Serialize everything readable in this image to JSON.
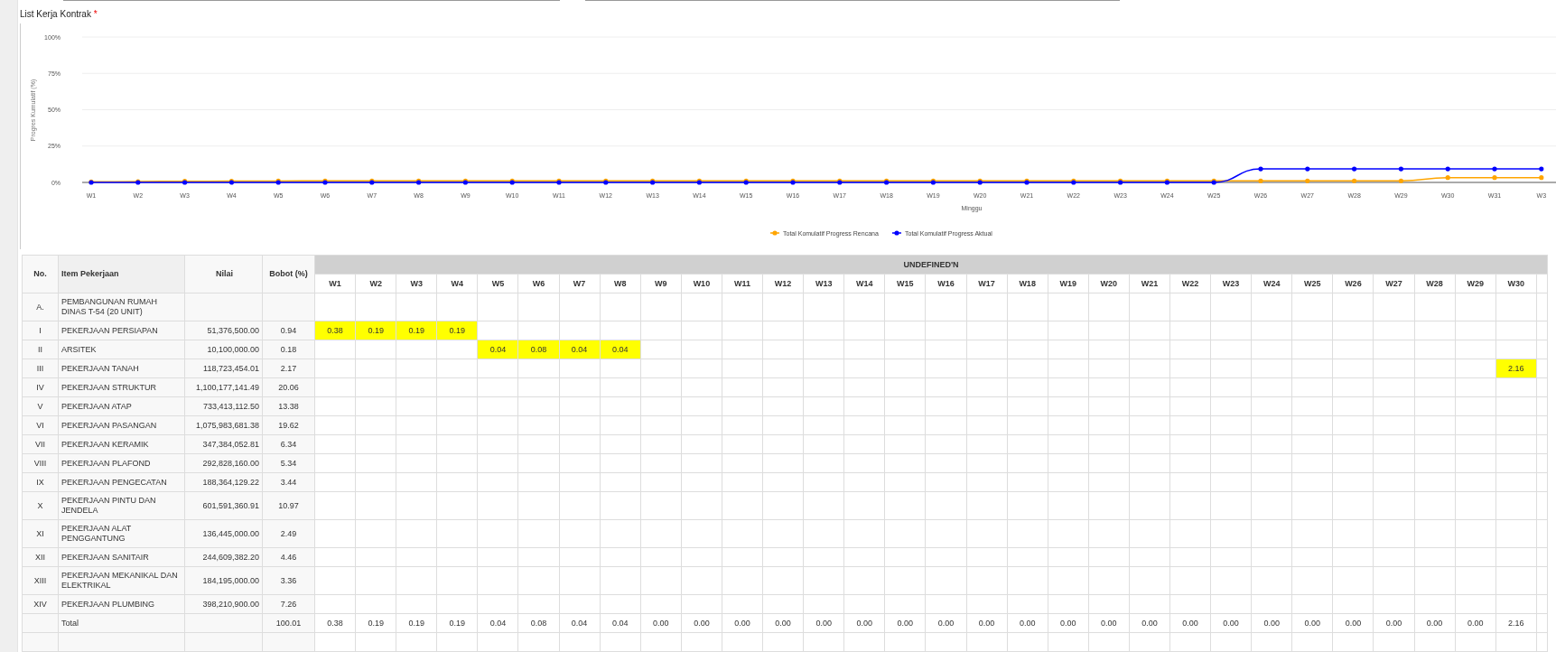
{
  "section": {
    "title": "List Kerja Kontrak",
    "required_mark": "*"
  },
  "chart": {
    "chart_data": {
      "type": "line",
      "grid": true,
      "legend": true,
      "xlabel": "Minggu",
      "ylabel": "Progres Kumulatif (%)",
      "categories": [
        "W1",
        "W2",
        "W3",
        "W4",
        "W5",
        "W6",
        "W7",
        "W8",
        "W9",
        "W10",
        "W11",
        "W12",
        "W13",
        "W14",
        "W15",
        "W16",
        "W17",
        "W18",
        "W19",
        "W20",
        "W21",
        "W22",
        "W23",
        "W24",
        "W25",
        "W26",
        "W27",
        "W28",
        "W29",
        "W30",
        "W31",
        "W3"
      ],
      "ylim": [
        0,
        100
      ],
      "yticks": [
        {
          "value": 0,
          "label": "0%"
        },
        {
          "value": 25,
          "label": "25%"
        },
        {
          "value": 50,
          "label": "50%"
        },
        {
          "value": 75,
          "label": "75%"
        },
        {
          "value": 100,
          "label": "100%"
        }
      ],
      "series": [
        {
          "name": "Total Komulatif Progress Rencana",
          "color": "#ffa500",
          "values": [
            0.4,
            0.6,
            0.8,
            0.9,
            1,
            1.1,
            1.1,
            1.1,
            1.1,
            1.1,
            1.1,
            1.1,
            1.1,
            1.1,
            1.1,
            1.1,
            1.1,
            1.1,
            1.1,
            1.1,
            1.1,
            1.1,
            1.1,
            1.1,
            1.1,
            1.1,
            1.1,
            1.1,
            1.1,
            3.3,
            3.3,
            3.3
          ]
        },
        {
          "name": "Total Komulatif Progress Aktual",
          "color": "#0000ff",
          "values": [
            0,
            0,
            0,
            0,
            0,
            0,
            0,
            0,
            0,
            0,
            0,
            0,
            0,
            0,
            0,
            0,
            0,
            0,
            0,
            0,
            0,
            0,
            0,
            0,
            0,
            9.3,
            9.3,
            9.3,
            9.3,
            9.3,
            9.3,
            9.3
          ]
        }
      ]
    }
  },
  "table": {
    "columns": {
      "no": "No.",
      "item": "Item Pekerjaan",
      "nilai": "Nilai",
      "bobot": "Bobot (%)",
      "group": "UNDEFINED'N",
      "weeks": [
        "W1",
        "W2",
        "W3",
        "W4",
        "W5",
        "W6",
        "W7",
        "W8",
        "W9",
        "W10",
        "W11",
        "W12",
        "W13",
        "W14",
        "W15",
        "W16",
        "W17",
        "W18",
        "W19",
        "W20",
        "W21",
        "W22",
        "W23",
        "W24",
        "W25",
        "W26",
        "W27",
        "W28",
        "W29",
        "W30"
      ]
    },
    "rows": [
      {
        "no": "A.",
        "item": "PEMBANGUNAN RUMAH DINAS T-54 (20 UNIT)",
        "cells": []
      },
      {
        "no": "I",
        "item": "PEKERJAAN PERSIAPAN",
        "nilai": "51,376,500.00",
        "bobot": "0.94",
        "cells": [
          {
            "value": "0.38",
            "highlighted": true
          },
          {
            "value": "0.19",
            "highlighted": true
          },
          {
            "value": "0.19",
            "highlighted": true
          },
          {
            "value": "0.19",
            "highlighted": true
          }
        ]
      },
      {
        "no": "II",
        "item": "ARSITEK",
        "nilai": "10,100,000.00",
        "bobot": "0.18",
        "cells": [
          null,
          null,
          null,
          null,
          {
            "value": "0.04",
            "highlighted": true
          },
          {
            "value": "0.08",
            "highlighted": true
          },
          {
            "value": "0.04",
            "highlighted": true
          },
          {
            "value": "0.04",
            "highlighted": true
          }
        ]
      },
      {
        "no": "III",
        "item": "PEKERJAAN TANAH",
        "nilai": "118,723,454.01",
        "bobot": "2.17",
        "cells": [
          null,
          null,
          null,
          null,
          null,
          null,
          null,
          null,
          null,
          null,
          null,
          null,
          null,
          null,
          null,
          null,
          null,
          null,
          null,
          null,
          null,
          null,
          null,
          null,
          null,
          null,
          null,
          null,
          null,
          {
            "value": "2.16",
            "highlighted": true
          }
        ]
      },
      {
        "no": "IV",
        "item": "PEKERJAAN STRUKTUR",
        "nilai": "1,100,177,141.49",
        "bobot": "20.06",
        "cells": []
      },
      {
        "no": "V",
        "item": "PEKERJAAN ATAP",
        "nilai": "733,413,112.50",
        "bobot": "13.38",
        "cells": []
      },
      {
        "no": "VI",
        "item": "PEKERJAAN PASANGAN",
        "nilai": "1,075,983,681.38",
        "bobot": "19.62",
        "cells": []
      },
      {
        "no": "VII",
        "item": "PEKERJAAN KERAMIK",
        "nilai": "347,384,052.81",
        "bobot": "6.34",
        "cells": []
      },
      {
        "no": "VIII",
        "item": "PEKERJAAN PLAFOND",
        "nilai": "292,828,160.00",
        "bobot": "5.34",
        "cells": []
      },
      {
        "no": "IX",
        "item": "PEKERJAAN PENGECATAN",
        "nilai": "188,364,129.22",
        "bobot": "3.44",
        "cells": []
      },
      {
        "no": "X",
        "item": "PEKERJAAN PINTU DAN JENDELA",
        "nilai": "601,591,360.91",
        "bobot": "10.97",
        "cells": []
      },
      {
        "no": "XI",
        "item": "PEKERJAAN ALAT PENGGANTUNG",
        "nilai": "136,445,000.00",
        "bobot": "2.49",
        "cells": []
      },
      {
        "no": "XII",
        "item": "PEKERJAAN SANITAIR",
        "nilai": "244,609,382.20",
        "bobot": "4.46",
        "cells": []
      },
      {
        "no": "XIII",
        "item": "PEKERJAAN MEKANIKAL DAN ELEKTRIKAL",
        "nilai": "184,195,000.00",
        "bobot": "3.36",
        "cells": []
      },
      {
        "no": "XIV",
        "item": "PEKERJAAN PLUMBING",
        "nilai": "398,210,900.00",
        "bobot": "7.26",
        "cells": []
      },
      {
        "item": "Total",
        "bobot": "100.01",
        "cells": [
          {
            "value": "0.38",
            "highlighted": false
          },
          {
            "value": "0.19",
            "highlighted": false
          },
          {
            "value": "0.19",
            "highlighted": false
          },
          {
            "value": "0.19",
            "highlighted": false
          },
          {
            "value": "0.04",
            "highlighted": false
          },
          {
            "value": "0.08",
            "highlighted": false
          },
          {
            "value": "0.04",
            "highlighted": false
          },
          {
            "value": "0.04",
            "highlighted": false
          },
          {
            "value": "0.00",
            "highlighted": false
          },
          {
            "value": "0.00",
            "highlighted": false
          },
          {
            "value": "0.00",
            "highlighted": false
          },
          {
            "value": "0.00",
            "highlighted": false
          },
          {
            "value": "0.00",
            "highlighted": false
          },
          {
            "value": "0.00",
            "highlighted": false
          },
          {
            "value": "0.00",
            "highlighted": false
          },
          {
            "value": "0.00",
            "highlighted": false
          },
          {
            "value": "0.00",
            "highlighted": false
          },
          {
            "value": "0.00",
            "highlighted": false
          },
          {
            "value": "0.00",
            "highlighted": false
          },
          {
            "value": "0.00",
            "highlighted": false
          },
          {
            "value": "0.00",
            "highlighted": false
          },
          {
            "value": "0.00",
            "highlighted": false
          },
          {
            "value": "0.00",
            "highlighted": false
          },
          {
            "value": "0.00",
            "highlighted": false
          },
          {
            "value": "0.00",
            "highlighted": false
          },
          {
            "value": "0.00",
            "highlighted": false
          },
          {
            "value": "0.00",
            "highlighted": false
          },
          {
            "value": "0.00",
            "highlighted": false
          },
          {
            "value": "0.00",
            "highlighted": false
          },
          {
            "value": "2.16",
            "highlighted": false
          }
        ]
      }
    ]
  }
}
